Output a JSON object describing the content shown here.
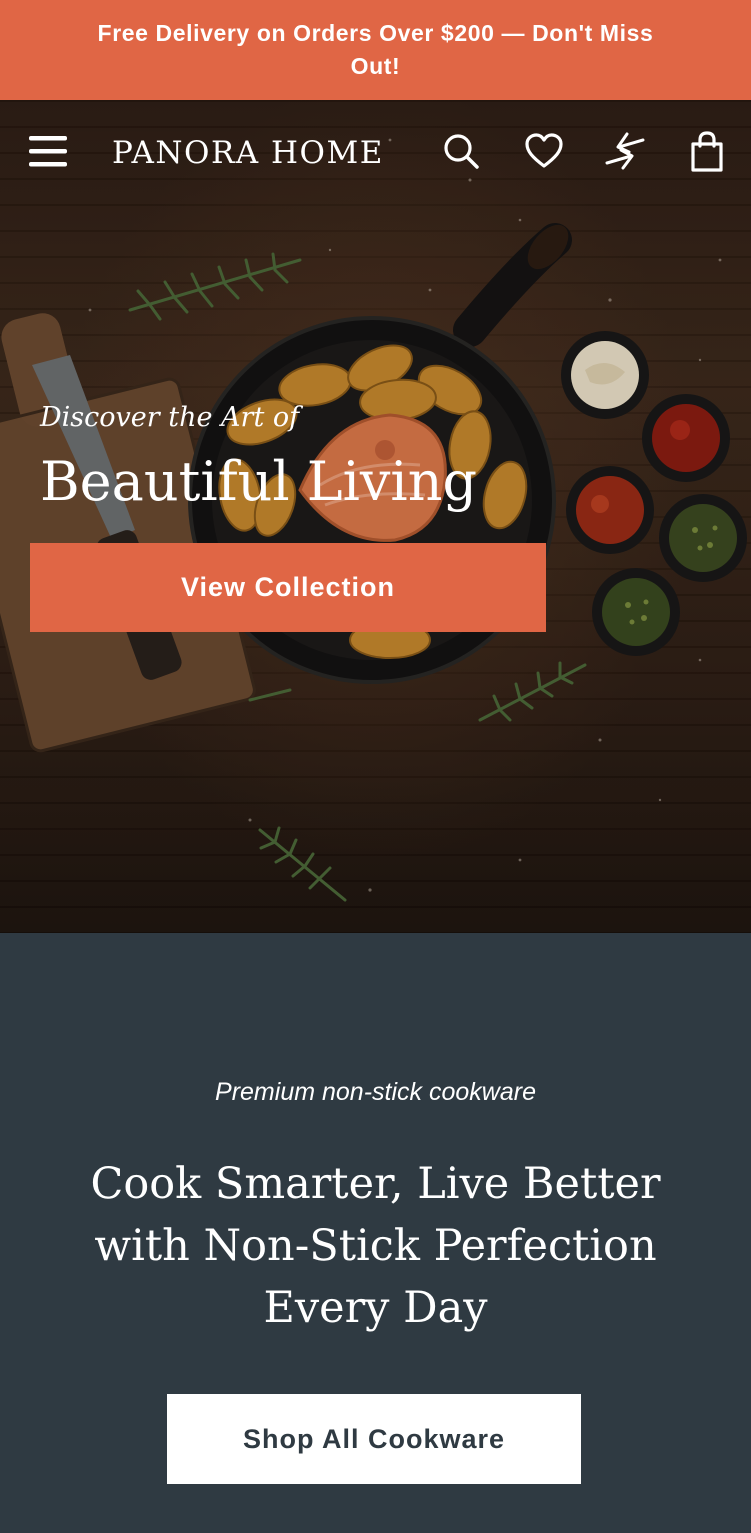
{
  "announcement": {
    "text": "Free Delivery on Orders Over $200 — Don't Miss Out!"
  },
  "header": {
    "brand": "PANORA HOME",
    "icons": [
      "menu-icon",
      "search-icon",
      "heart-icon",
      "compare-icon",
      "bag-icon"
    ]
  },
  "hero": {
    "eyebrow": "Discover the Art of",
    "title": "Beautiful Living",
    "cta_label": "View Collection"
  },
  "promo": {
    "eyebrow": "Premium non-stick cookware",
    "title": "Cook Smarter, Live Better with Non-Stick Perfection Every Day",
    "cta_label": "Shop All Cookware"
  },
  "colors": {
    "accent": "#e06645",
    "section_bg": "#2f3a42",
    "text_light": "#ffffff"
  }
}
